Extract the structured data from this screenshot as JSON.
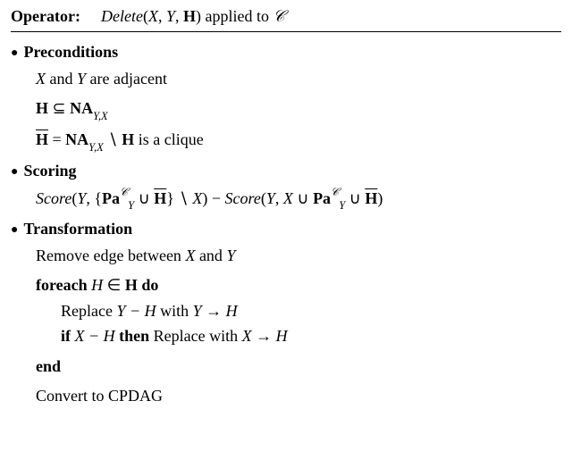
{
  "operator": {
    "label": "Operator:",
    "name": "Delete",
    "args": "(X, Y, H)",
    "applied_to": "applied to"
  },
  "sections": {
    "preconditions": "Preconditions",
    "scoring": "Scoring",
    "transformation": "Transformation"
  },
  "preconditions": {
    "l1a": "X",
    "l1b": " and ",
    "l1c": "Y",
    "l1d": " are adjacent",
    "l2a": "H",
    "l2b": " ⊆ ",
    "l2c": "NA",
    "l2sub": "Y,X",
    "l3a": "H",
    "l3b": " = ",
    "l3c": "NA",
    "l3sub": "Y,X",
    "l3d": " ∖ ",
    "l3e": "H",
    "l3f": " is a clique"
  },
  "scoring": {
    "pre1": "Score",
    "open": "(",
    "y": "Y",
    "comma": ", ",
    "lb": "{",
    "pa": "Pa",
    "paSub": "Y",
    "cup": " ∪ ",
    "hbar": "H",
    "rb": "}",
    "setminus": " ∖ ",
    "x": "X",
    "close": ")",
    "minus": " − ",
    "pre2": "Score",
    "xcup": "X ∪ "
  },
  "transformation": {
    "l1a": "Remove edge between ",
    "l1b": "X",
    "l1c": " and ",
    "l1d": "Y",
    "foreach": "foreach ",
    "H": "H",
    "in": " ∈ ",
    "Hb": "H",
    "do": " do",
    "r1a": "Replace ",
    "r1b": "Y − H",
    "r1c": " with ",
    "r1d": "Y → H",
    "if": "if ",
    "cond": "X − H",
    "then": " then ",
    "r2a": "Replace with ",
    "r2b": "X → H",
    "end": "end",
    "last": "Convert to CPDAG"
  }
}
